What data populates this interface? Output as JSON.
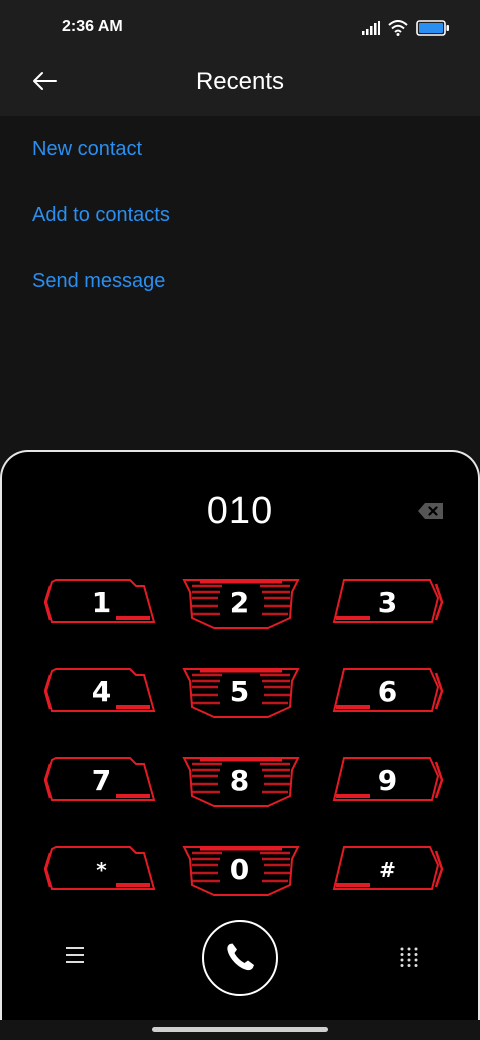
{
  "status_bar": {
    "time": "2:36 AM",
    "icons": [
      "signal-icon",
      "wifi-icon",
      "battery-icon"
    ]
  },
  "toolbar": {
    "title": "Recents",
    "back_icon": "arrow-left-icon"
  },
  "menu": {
    "items": [
      "New contact",
      "Add to contacts",
      "Send message"
    ]
  },
  "dialer": {
    "number": "010",
    "backspace_icon": "backspace-icon",
    "keys": [
      "1",
      "2",
      "3",
      "4",
      "5",
      "6",
      "7",
      "8",
      "9",
      "*",
      "0",
      "#"
    ],
    "menu_icon": "hamburger-menu-icon",
    "call_icon": "phone-icon",
    "dialpad_toggle_icon": "dialpad-grid-icon"
  },
  "colors": {
    "accent": "#2a8ff0",
    "key_red": "#e21b24",
    "panel_bg": "#000000",
    "app_bg": "#141414"
  }
}
